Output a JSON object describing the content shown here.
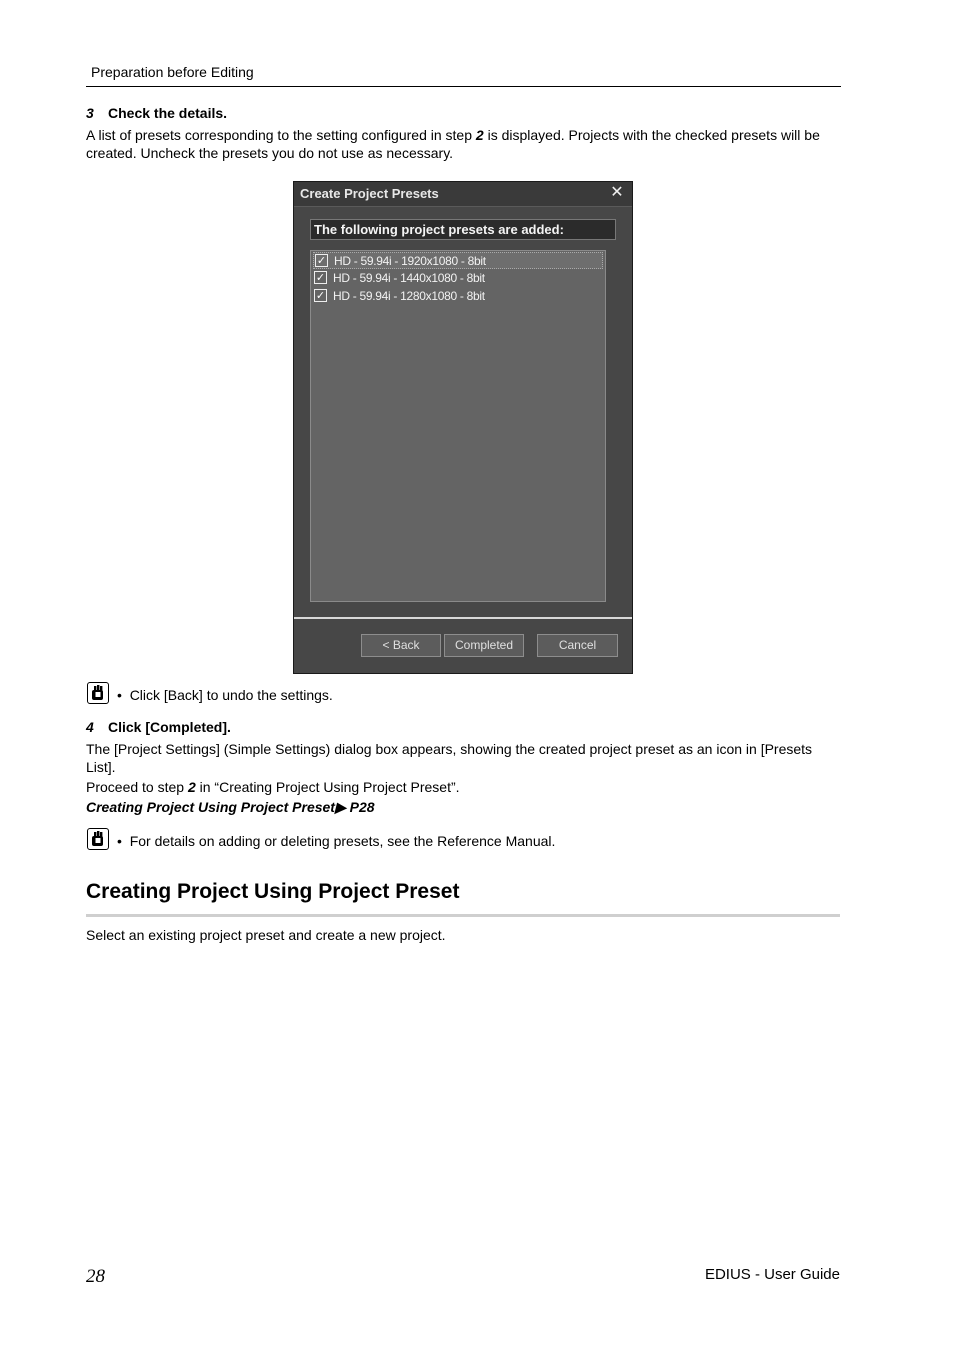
{
  "header": {
    "running_title": "Preparation before Editing"
  },
  "step3": {
    "number": "3",
    "title": "Check the details.",
    "para_pre": "A list of presets corresponding to the setting configured in step ",
    "para_step": "2",
    "para_post": " is displayed. Projects with the checked presets will be created. Uncheck the presets you do not use as necessary."
  },
  "dialog": {
    "title": "Create Project Presets",
    "close_glyph": "✕",
    "banner": "The following project presets are added:",
    "presets": [
      {
        "label": "HD - 59.94i - 1920x1080 - 8bit",
        "checked": true
      },
      {
        "label": "HD - 59.94i - 1440x1080 - 8bit",
        "checked": true
      },
      {
        "label": "HD - 59.94i - 1280x1080 - 8bit",
        "checked": true
      }
    ],
    "back_label": "< Back",
    "completed_label": "Completed",
    "cancel_label": "Cancel"
  },
  "note1": {
    "bullet": "•",
    "text": "Click [Back] to undo the settings."
  },
  "step4": {
    "number": "4",
    "title": "Click [Completed].",
    "para1": "The [Project Settings] (Simple Settings) dialog box appears, showing the created project preset as an icon in [Presets List].",
    "para2_pre": "Proceed to step ",
    "para2_step": "2",
    "para2_post": " in “Creating Project Using Project Preset”.",
    "link_text": "Creating Project Using Project Preset",
    "link_page": "P28"
  },
  "note2": {
    "bullet": "•",
    "text": "For details on adding or deleting presets, see the Reference Manual."
  },
  "section": {
    "title": "Creating Project Using Project Preset",
    "intro": "Select an existing project preset and create a new project."
  },
  "footer": {
    "page_number": "28",
    "guide_title": "EDIUS - User Guide"
  },
  "colors": {
    "dialog_bg": "#474747",
    "list_bg": "#646464"
  }
}
